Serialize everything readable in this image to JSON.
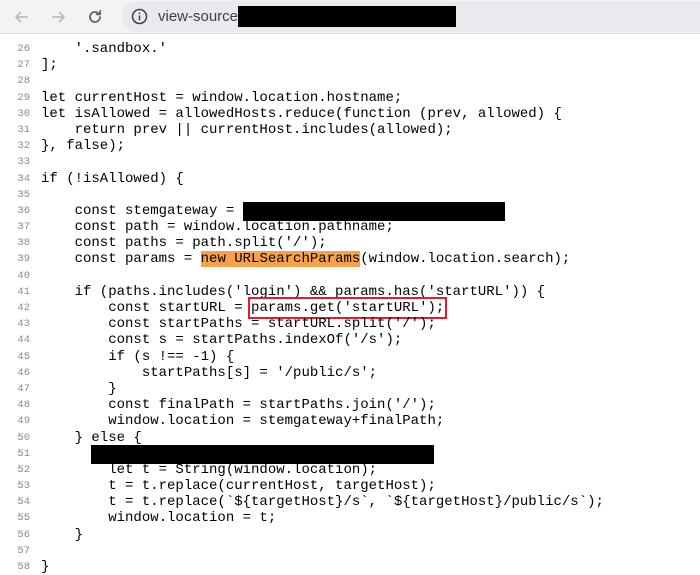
{
  "browser": {
    "url_prefix": "view-source:",
    "icons": [
      "back-arrow-icon",
      "forward-arrow-icon",
      "reload-icon",
      "info-icon"
    ]
  },
  "colors": {
    "highlight": "#f7a24a",
    "callout_box": "#e8182e",
    "redaction": "#000000"
  },
  "code_lines": [
    {
      "n": "26",
      "parts": [
        {
          "t": "    '.sandbox.'"
        }
      ]
    },
    {
      "n": "27",
      "parts": [
        {
          "t": "];"
        }
      ]
    },
    {
      "n": "28",
      "parts": []
    },
    {
      "n": "29",
      "parts": [
        {
          "t": "let currentHost = window.location.hostname;"
        }
      ]
    },
    {
      "n": "30",
      "parts": [
        {
          "t": "let isAllowed = allowedHosts.reduce(function (prev, allowed) {"
        }
      ]
    },
    {
      "n": "31",
      "parts": [
        {
          "t": "    return prev || currentHost.includes(allowed);"
        }
      ]
    },
    {
      "n": "32",
      "parts": [
        {
          "t": "}, false);"
        }
      ]
    },
    {
      "n": "33",
      "parts": []
    },
    {
      "n": "34",
      "parts": [
        {
          "t": "if (!isAllowed) {"
        }
      ]
    },
    {
      "n": "35",
      "parts": []
    },
    {
      "n": "36",
      "parts": [
        {
          "t": "    const stemgateway = "
        },
        {
          "redacted": true,
          "w": 262
        }
      ]
    },
    {
      "n": "37",
      "parts": [
        {
          "t": "    const path = window.location.pathname;"
        }
      ]
    },
    {
      "n": "38",
      "parts": [
        {
          "t": "    const paths = path.split('/');"
        }
      ]
    },
    {
      "n": "39",
      "parts": [
        {
          "t": "    const params = "
        },
        {
          "t": "new URLSearchParams",
          "hl": true
        },
        {
          "t": "(window.location.search);"
        }
      ]
    },
    {
      "n": "40",
      "parts": []
    },
    {
      "n": "41",
      "parts": [
        {
          "t": "    if (paths.includes('login') && params.has('startURL')) {"
        }
      ]
    },
    {
      "n": "42",
      "parts": [
        {
          "t": "        const startURL = "
        },
        {
          "t": "params.get('startURL');",
          "box": true
        }
      ]
    },
    {
      "n": "43",
      "parts": [
        {
          "t": "        const startPaths = startURL.split('/');"
        }
      ]
    },
    {
      "n": "44",
      "parts": [
        {
          "t": "        const s = startPaths.indexOf('/s');"
        }
      ]
    },
    {
      "n": "45",
      "parts": [
        {
          "t": "        if (s !== -1) {"
        }
      ]
    },
    {
      "n": "46",
      "parts": [
        {
          "t": "            startPaths[s] = '/public/s';"
        }
      ]
    },
    {
      "n": "47",
      "parts": [
        {
          "t": "        }"
        }
      ]
    },
    {
      "n": "48",
      "parts": [
        {
          "t": "        const finalPath = startPaths.join('/');"
        }
      ]
    },
    {
      "n": "49",
      "parts": [
        {
          "t": "        window.location = stemgateway+finalPath;"
        }
      ]
    },
    {
      "n": "50",
      "parts": [
        {
          "t": "    } else {"
        }
      ]
    },
    {
      "n": "51",
      "parts": [
        {
          "t": "      "
        },
        {
          "redacted": true,
          "w": 343
        }
      ]
    },
    {
      "n": "52",
      "parts": [
        {
          "t": "        let t = String(window.location);"
        }
      ]
    },
    {
      "n": "53",
      "parts": [
        {
          "t": "        t = t.replace(currentHost, targetHost);"
        }
      ]
    },
    {
      "n": "54",
      "parts": [
        {
          "t": "        t = t.replace(`${targetHost}/s`, `${targetHost}/public/s`);"
        }
      ]
    },
    {
      "n": "55",
      "parts": [
        {
          "t": "        window.location = t;"
        }
      ]
    },
    {
      "n": "56",
      "parts": [
        {
          "t": "    }"
        }
      ]
    },
    {
      "n": "57",
      "parts": []
    },
    {
      "n": "58",
      "parts": [
        {
          "t": "}"
        }
      ]
    }
  ]
}
